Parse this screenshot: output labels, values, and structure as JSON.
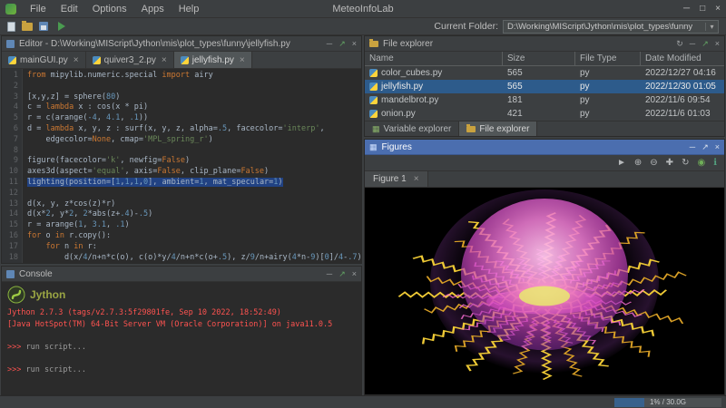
{
  "window": {
    "title": "MeteoInfoLab",
    "menu_items": [
      "File",
      "Edit",
      "Options",
      "Apps",
      "Help"
    ]
  },
  "icons": {
    "close": "×",
    "win_min": "─",
    "win_max": "□",
    "win_close": "×",
    "minimize_panel": "─",
    "float_panel": "↗",
    "refresh": "↻",
    "dropdown": "▾",
    "pointer": "►",
    "zoom_in": "⊕",
    "zoom_out": "⊖",
    "pan": "✚",
    "rotate": "↻",
    "globe": "◉",
    "info": "ℹ",
    "grid": "▦"
  },
  "toolbar": {
    "current_folder_label": "Current Folder:",
    "current_folder_value": "D:\\Working\\MIScript\\Jython\\mis\\plot_types\\funny"
  },
  "editor": {
    "title": "Editor - D:\\Working\\MIScript\\Jython\\mis\\plot_types\\funny\\jellyfish.py",
    "tabs": [
      {
        "label": "mainGUI.py"
      },
      {
        "label": "quiver3_2.py"
      },
      {
        "label": "jellyfish.py"
      }
    ],
    "lines": [
      {
        "segs": [
          [
            "kw",
            "from"
          ],
          [
            "pl",
            " mipylib.numeric.special "
          ],
          [
            "kw",
            "import"
          ],
          [
            "pl",
            " airy"
          ]
        ]
      },
      {
        "segs": []
      },
      {
        "segs": [
          [
            "pl",
            "[x,y,z] = sphere("
          ],
          [
            "num",
            "80"
          ],
          [
            "pl",
            ")"
          ]
        ]
      },
      {
        "segs": [
          [
            "pl",
            "c = "
          ],
          [
            "kw",
            "lambda"
          ],
          [
            "pl",
            " x : cos(x * pi)"
          ]
        ]
      },
      {
        "segs": [
          [
            "pl",
            "r = c(arange("
          ],
          [
            "num",
            "-4"
          ],
          [
            "pl",
            ", "
          ],
          [
            "num",
            "4.1"
          ],
          [
            "pl",
            ", "
          ],
          [
            "num",
            ".1"
          ],
          [
            "pl",
            "))"
          ]
        ]
      },
      {
        "segs": [
          [
            "pl",
            "d = "
          ],
          [
            "kw",
            "lambda"
          ],
          [
            "pl",
            " x, y, z : surf(x, y, z, alpha="
          ],
          [
            "num",
            ".5"
          ],
          [
            "pl",
            ", facecolor="
          ],
          [
            "str",
            "'interp'"
          ],
          [
            "pl",
            ","
          ]
        ]
      },
      {
        "segs": [
          [
            "pl",
            "    edgecolor="
          ],
          [
            "kw",
            "None"
          ],
          [
            "pl",
            ", cmap="
          ],
          [
            "str",
            "'MPL_spring_r'"
          ],
          [
            "pl",
            ")"
          ]
        ]
      },
      {
        "segs": []
      },
      {
        "segs": [
          [
            "pl",
            "figure(facecolor="
          ],
          [
            "str",
            "'k'"
          ],
          [
            "pl",
            ", newfig="
          ],
          [
            "kw",
            "False"
          ],
          [
            "pl",
            ")"
          ]
        ]
      },
      {
        "segs": [
          [
            "pl",
            "axes3d(aspect="
          ],
          [
            "str",
            "'equal'"
          ],
          [
            "pl",
            ", axis="
          ],
          [
            "kw",
            "False"
          ],
          [
            "pl",
            ", clip_plane="
          ],
          [
            "kw",
            "False"
          ],
          [
            "pl",
            ")"
          ]
        ]
      },
      {
        "sel": true,
        "segs": [
          [
            "pl",
            "lighting(position=["
          ],
          [
            "num",
            "1"
          ],
          [
            "pl",
            ","
          ],
          [
            "num",
            "1"
          ],
          [
            "pl",
            ","
          ],
          [
            "num",
            "1"
          ],
          [
            "pl",
            ","
          ],
          [
            "num",
            "0"
          ],
          [
            "pl",
            "], ambient="
          ],
          [
            "num",
            "1"
          ],
          [
            "pl",
            ", mat_specular="
          ],
          [
            "num",
            "1"
          ],
          [
            "pl",
            ")"
          ]
        ]
      },
      {
        "segs": []
      },
      {
        "segs": [
          [
            "pl",
            "d(x, y, z*cos(z)*r)"
          ]
        ]
      },
      {
        "segs": [
          [
            "pl",
            "d(x*"
          ],
          [
            "num",
            "2"
          ],
          [
            "pl",
            ", y*"
          ],
          [
            "num",
            "2"
          ],
          [
            "pl",
            ", "
          ],
          [
            "num",
            "2"
          ],
          [
            "pl",
            "*abs(z+"
          ],
          [
            "num",
            ".4"
          ],
          [
            "pl",
            ")-"
          ],
          [
            "num",
            ".5"
          ],
          [
            "pl",
            ")"
          ]
        ]
      },
      {
        "segs": [
          [
            "pl",
            "r = arange("
          ],
          [
            "num",
            "1"
          ],
          [
            "pl",
            ", "
          ],
          [
            "num",
            "3.1"
          ],
          [
            "pl",
            ", "
          ],
          [
            "num",
            ".1"
          ],
          [
            "pl",
            ")"
          ]
        ]
      },
      {
        "segs": [
          [
            "kw",
            "for"
          ],
          [
            "pl",
            " o "
          ],
          [
            "kw",
            "in"
          ],
          [
            "pl",
            " r.copy():"
          ]
        ]
      },
      {
        "segs": [
          [
            "pl",
            "    "
          ],
          [
            "kw",
            "for"
          ],
          [
            "pl",
            " n "
          ],
          [
            "kw",
            "in"
          ],
          [
            "pl",
            " r:"
          ]
        ]
      },
      {
        "segs": [
          [
            "pl",
            "        d(x/"
          ],
          [
            "num",
            "4"
          ],
          [
            "pl",
            "/n+n*c(o), c(o)*y/"
          ],
          [
            "num",
            "4"
          ],
          [
            "pl",
            "/n+n*c(o+"
          ],
          [
            "num",
            ".5"
          ],
          [
            "pl",
            "), z/"
          ],
          [
            "num",
            "9"
          ],
          [
            "pl",
            "/n+airy("
          ],
          [
            "num",
            "4"
          ],
          [
            "pl",
            "*n-"
          ],
          [
            "num",
            "9"
          ],
          [
            "pl",
            ")["
          ],
          [
            "num",
            "0"
          ],
          [
            "pl",
            "]/"
          ],
          [
            "num",
            "4"
          ],
          [
            "pl",
            "-"
          ],
          [
            "num",
            ".7"
          ],
          [
            "pl",
            ")"
          ]
        ]
      }
    ]
  },
  "console": {
    "title": "Console",
    "logo_text": "Jython",
    "lines": [
      {
        "cls": "err",
        "text": "Jython 2.7.3 (tags/v2.7.3:5f29801fe, Sep 10 2022, 18:52:49)"
      },
      {
        "cls": "err",
        "text": "[Java HotSpot(TM) 64-Bit Server VM (Oracle Corporation)] on java11.0.5"
      },
      {
        "cls": "sp",
        "text": ""
      },
      {
        "cls": "cmd",
        "prompt": ">>> ",
        "text": "run script..."
      },
      {
        "cls": "sp",
        "text": ""
      },
      {
        "cls": "cmd",
        "prompt": ">>> ",
        "text": "run script..."
      }
    ]
  },
  "file_explorer": {
    "title": "File explorer",
    "columns": [
      "Name",
      "Size",
      "File Type",
      "Date Modified"
    ],
    "rows": [
      {
        "name": "color_cubes.py",
        "size": "565",
        "type": "py",
        "modified": "2022/12/27 04:16",
        "selected": false
      },
      {
        "name": "jellyfish.py",
        "size": "565",
        "type": "py",
        "modified": "2022/12/30 01:05",
        "selected": true
      },
      {
        "name": "mandelbrot.py",
        "size": "181",
        "type": "py",
        "modified": "2022/11/6 09:54",
        "selected": false
      },
      {
        "name": "onion.py",
        "size": "421",
        "type": "py",
        "modified": "2022/11/6 01:03",
        "selected": false
      }
    ],
    "bottom_tabs": [
      {
        "label": "Variable explorer"
      },
      {
        "label": "File explorer"
      }
    ]
  },
  "figures": {
    "title": "Figures",
    "tab_label": "Figure 1"
  },
  "status": {
    "memory": "1% / 30.0G"
  }
}
